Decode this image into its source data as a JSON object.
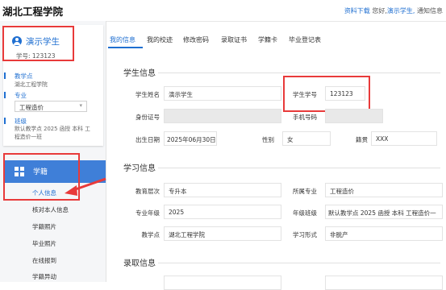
{
  "header": {
    "school_name": "湖北工程学院",
    "download_link": "资料下载",
    "greeting": "您好,",
    "user_link": "演示学生,",
    "notice_link": "通知信息"
  },
  "sidebar": {
    "user_name": "演示学生",
    "student_id_line": "学号: 123123",
    "teaching_point_label": "教学点",
    "teaching_point_value": "湖北工程学院",
    "major_label": "专业",
    "major_selected": "工程造价",
    "class_label": "班级",
    "class_value_line1": "默认教学点 2025 函授 本科 工",
    "class_value_line2": "程造价一班",
    "menu_active_label": "学籍",
    "submenu": [
      "个人信息",
      "核对本人信息",
      "学籍照片",
      "毕业照片",
      "在线报到",
      "学籍异动"
    ]
  },
  "tabs": [
    "我的信息",
    "我的校迹",
    "修改密码",
    "录取证书",
    "学籍卡",
    "毕业登记表"
  ],
  "sections": {
    "student_info": {
      "title": "学生信息",
      "name_label": "学生姓名",
      "name_value": "演示学生",
      "student_no_label": "学生学号",
      "student_no_value": "123123",
      "id_label": "身份证号",
      "id_value": "",
      "phone_label": "手机号码",
      "phone_value": "",
      "birth_label": "出生日期",
      "birth_value": "2025年06月30日",
      "gender_label": "性别",
      "gender_value": "女",
      "native_label": "籍贯",
      "native_value": "XXX"
    },
    "study_info": {
      "title": "学习信息",
      "level_label": "教育层次",
      "level_value": "专升本",
      "major_label": "所属专业",
      "major_value": "工程造价",
      "grade_label": "专业年级",
      "grade_value": "2025",
      "class_label": "年级班级",
      "class_value": "默认教学点 2025 函授 本科 工程造价一",
      "point_label": "教学点",
      "point_value": "湖北工程学院",
      "form_label": "学习形式",
      "form_value": "非脱产"
    },
    "admission_info": {
      "title": "录取信息"
    }
  },
  "colors": {
    "accent": "#1f6fd1",
    "highlight": "#e83a3a",
    "menu_active_bg": "#3f7fd8"
  }
}
